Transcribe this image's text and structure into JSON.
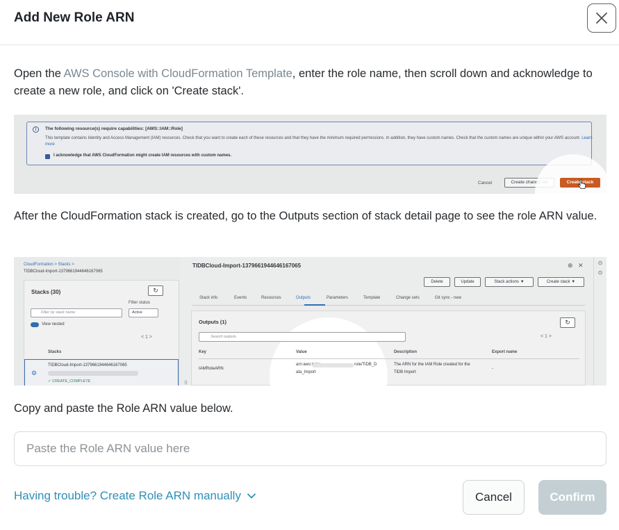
{
  "dialog": {
    "title": "Add New Role ARN"
  },
  "step1": {
    "prefix": "Open the ",
    "link": "AWS Console with CloudFormation Template",
    "suffix": ", enter the role name, then scroll down and acknowledge to create a new role, and click on 'Create stack'."
  },
  "screenshot1": {
    "capabilities_title": "The following resource(s) require capabilities: [AWS::IAM::Role]",
    "capabilities_text": "This template contains Identity and Access Management (IAM) resources. Check that you want to create each of these resources and that they have the minimum required permissions. In addition, they have custom names. Check that the custom names are unique within your AWS account.",
    "learn_more": "Learn more",
    "acknowledge": "I acknowledge that AWS CloudFormation might create IAM resources with custom names.",
    "cancel": "Cancel",
    "create_change_set": "Create change set",
    "create_stack": "Create stack"
  },
  "step2": {
    "text": "After the CloudFormation stack is created, go to the Outputs section of stack detail page to see the role ARN value."
  },
  "screenshot2": {
    "breadcrumb_root": "CloudFormation",
    "breadcrumb_stacks": "Stacks",
    "breadcrumb_current": "TIDBCloud-Import-1379661944646167065",
    "stacks_title": "Stacks (30)",
    "filter_status_label": "Filter status",
    "filter_placeholder": "Filter by stack name",
    "filter_status_value": "Active",
    "view_nested": "View nested",
    "pagination": "< 1 >",
    "stacks_column": "Stacks",
    "stack_row_name": "TIDBCloud-Import-1379661944646167065",
    "stack_status": "CREATE_COMPLETE",
    "stack_title": "TIDBCloud-Import-1379661944646167065",
    "buttons": [
      "Delete",
      "Update",
      "Stack actions ▼",
      "Create stack ▼"
    ],
    "tabs": [
      "Stack info",
      "Events",
      "Resources",
      "Outputs",
      "Parameters",
      "Template",
      "Change sets",
      "Git sync - new"
    ],
    "active_tab": "Outputs",
    "outputs_title": "Outputs (1)",
    "search_placeholder": "Search outputs",
    "columns": [
      "Key",
      "Value",
      "Description",
      "Export name"
    ],
    "row": {
      "key": "IAMRoleARN",
      "value_prefix": "arn:aws:iam::",
      "value_suffix": "role/TiDB_D",
      "value_line2": "ata_Import",
      "description_line1": "The ARN for the IAM Role created for the",
      "description_line2": "TiDB Import",
      "export": "-"
    }
  },
  "step3": {
    "text": "Copy and paste the Role ARN value below."
  },
  "arn_input": {
    "value": "",
    "placeholder": "Paste the Role ARN value here"
  },
  "footer": {
    "trouble_link": "Having trouble? Create Role ARN manually",
    "cancel": "Cancel",
    "confirm": "Confirm"
  },
  "icons": {
    "close": "close-icon",
    "chevron": "chevron-down-icon"
  },
  "colors": {
    "link": "#2f8fb8",
    "muted_link": "#7a8791",
    "confirm_disabled": "#c3cfd3",
    "aws_orange": "#c85a23"
  }
}
